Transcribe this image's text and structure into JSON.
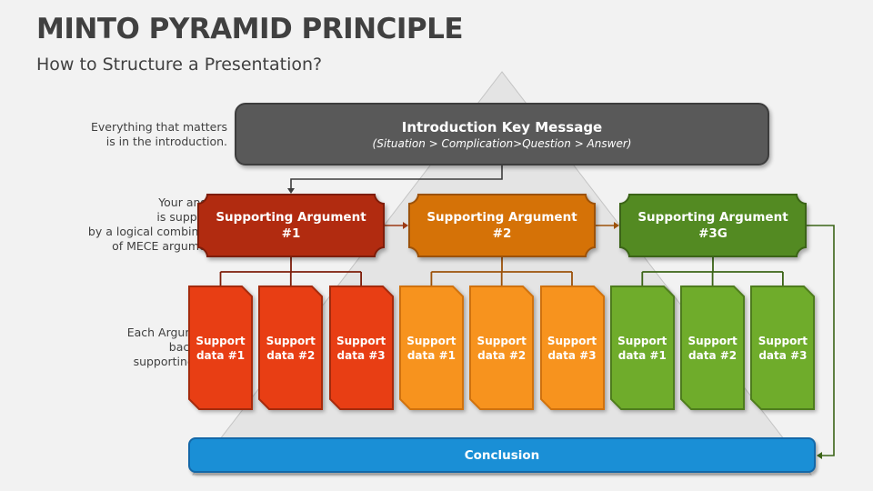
{
  "header": {
    "title": "MINTO PYRAMID PRINCIPLE",
    "subtitle": "How to Structure a Presentation?"
  },
  "side_notes": {
    "intro_note": [
      "Everything that matters",
      "is in the introduction."
    ],
    "argument_note": [
      "Your answer",
      "is supported",
      "by a logical combination",
      "of MECE arguments."
    ],
    "data_note": [
      "Each Argument is",
      "backed by",
      "supporting data."
    ]
  },
  "intro": {
    "title": "Introduction Key Message",
    "subtitle": "(Situation > Complication>Question > Answer)"
  },
  "arguments": [
    {
      "line1": "Supporting Argument",
      "line2": "#1",
      "fill": "#b12b10",
      "stroke": "#7e1d0a",
      "card_fill": "#e83e14",
      "card_stroke": "#a52a0c",
      "cards": [
        {
          "line1": "Support",
          "line2": "data #1"
        },
        {
          "line1": "Support",
          "line2": "data #2"
        },
        {
          "line1": "Support",
          "line2": "data #3"
        }
      ]
    },
    {
      "line1": "Supporting Argument",
      "line2": "#2",
      "fill": "#d57207",
      "stroke": "#9c520a",
      "card_fill": "#f7931e",
      "card_stroke": "#d0720e",
      "cards": [
        {
          "line1": "Support",
          "line2": "data #1"
        },
        {
          "line1": "Support",
          "line2": "data #2"
        },
        {
          "line1": "Support",
          "line2": "data #3"
        }
      ]
    },
    {
      "line1": "Supporting Argument",
      "line2": "#3G",
      "fill": "#538a22",
      "stroke": "#3b6417",
      "card_fill": "#6fac2b",
      "card_stroke": "#4e7d1d",
      "cards": [
        {
          "line1": "Support",
          "line2": "data #1"
        },
        {
          "line1": "Support",
          "line2": "data #2"
        },
        {
          "line1": "Support",
          "line2": "data #3"
        }
      ]
    }
  ],
  "conclusion": {
    "label": "Conclusion"
  },
  "colors": {
    "background": "#f2f2f2",
    "pyramid_fill": "#e4e4e4",
    "pyramid_stroke": "#c4c4c4",
    "intro_fill": "#595959",
    "conclusion_fill": "#1a8fd6",
    "connector_dark": "#3d3d3d"
  }
}
